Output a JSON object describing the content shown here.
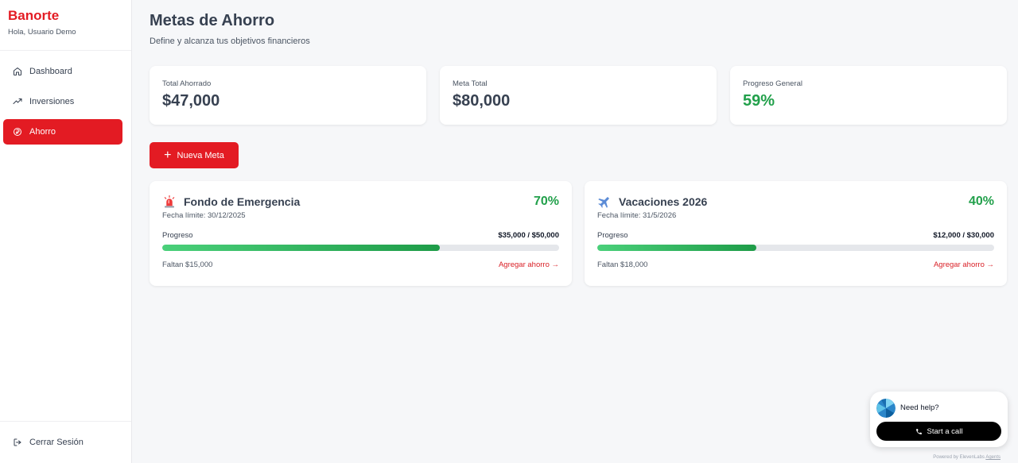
{
  "sidebar": {
    "brand": "Banorte",
    "greeting": "Hola, Usuario Demo",
    "items": [
      {
        "label": "Dashboard",
        "icon": "home-icon"
      },
      {
        "label": "Inversiones",
        "icon": "trending-up-icon"
      },
      {
        "label": "Ahorro",
        "icon": "coin-icon",
        "active": true
      }
    ],
    "logout": "Cerrar Sesión"
  },
  "header": {
    "title": "Metas de Ahorro",
    "subtitle": "Define y alcanza tus objetivos financieros"
  },
  "stats": [
    {
      "label": "Total Ahorrado",
      "value": "$47,000"
    },
    {
      "label": "Meta Total",
      "value": "$80,000"
    },
    {
      "label": "Progreso General",
      "value": "59%"
    }
  ],
  "new_goal_button": "Nueva Meta",
  "goals": [
    {
      "icon": "siren-icon",
      "title": "Fondo de Emergencia",
      "percent": "70%",
      "progress": 0.7,
      "date": "Fecha límite: 30/12/2025",
      "progress_label": "Progreso",
      "amount": "$35,000 / $50,000",
      "remaining": "Faltan $15,000",
      "action": "Agregar ahorro →"
    },
    {
      "icon": "airplane-icon",
      "title": "Vacaciones 2026",
      "percent": "40%",
      "progress": 0.4,
      "date": "Fecha límite: 31/5/2026",
      "progress_label": "Progreso",
      "amount": "$12,000 / $30,000",
      "remaining": "Faltan $18,000",
      "action": "Agregar ahorro →"
    }
  ],
  "help": {
    "text": "Need help?",
    "button": "Start a call",
    "powered_prefix": "Powered by ElevenLabs",
    "powered_link": "Agents"
  },
  "colors": {
    "brand": "#e31b23",
    "success": "#22a04b"
  }
}
